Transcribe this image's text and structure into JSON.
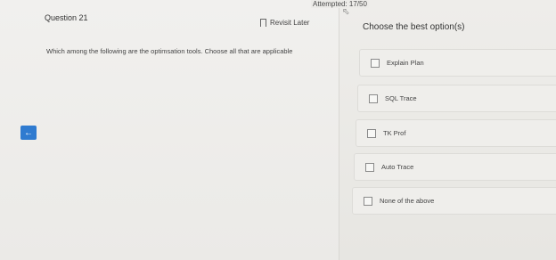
{
  "header": {
    "attempted": "Attempted: 17/50"
  },
  "question": {
    "number_label": "Question 21",
    "revisit_label": "Revisit Later",
    "text": "Which among the following are the optimsation tools. Choose all that are applicable"
  },
  "answers": {
    "heading": "Choose the best option(s)",
    "options": [
      {
        "label": "Explain Plan"
      },
      {
        "label": "SQL Trace"
      },
      {
        "label": "TK Prof"
      },
      {
        "label": "Auto Trace"
      },
      {
        "label": "None of the above"
      }
    ]
  },
  "nav": {
    "back_icon": "arrow-left-icon"
  },
  "colors": {
    "accent": "#2f7bd0",
    "background": "#ecebe8"
  }
}
